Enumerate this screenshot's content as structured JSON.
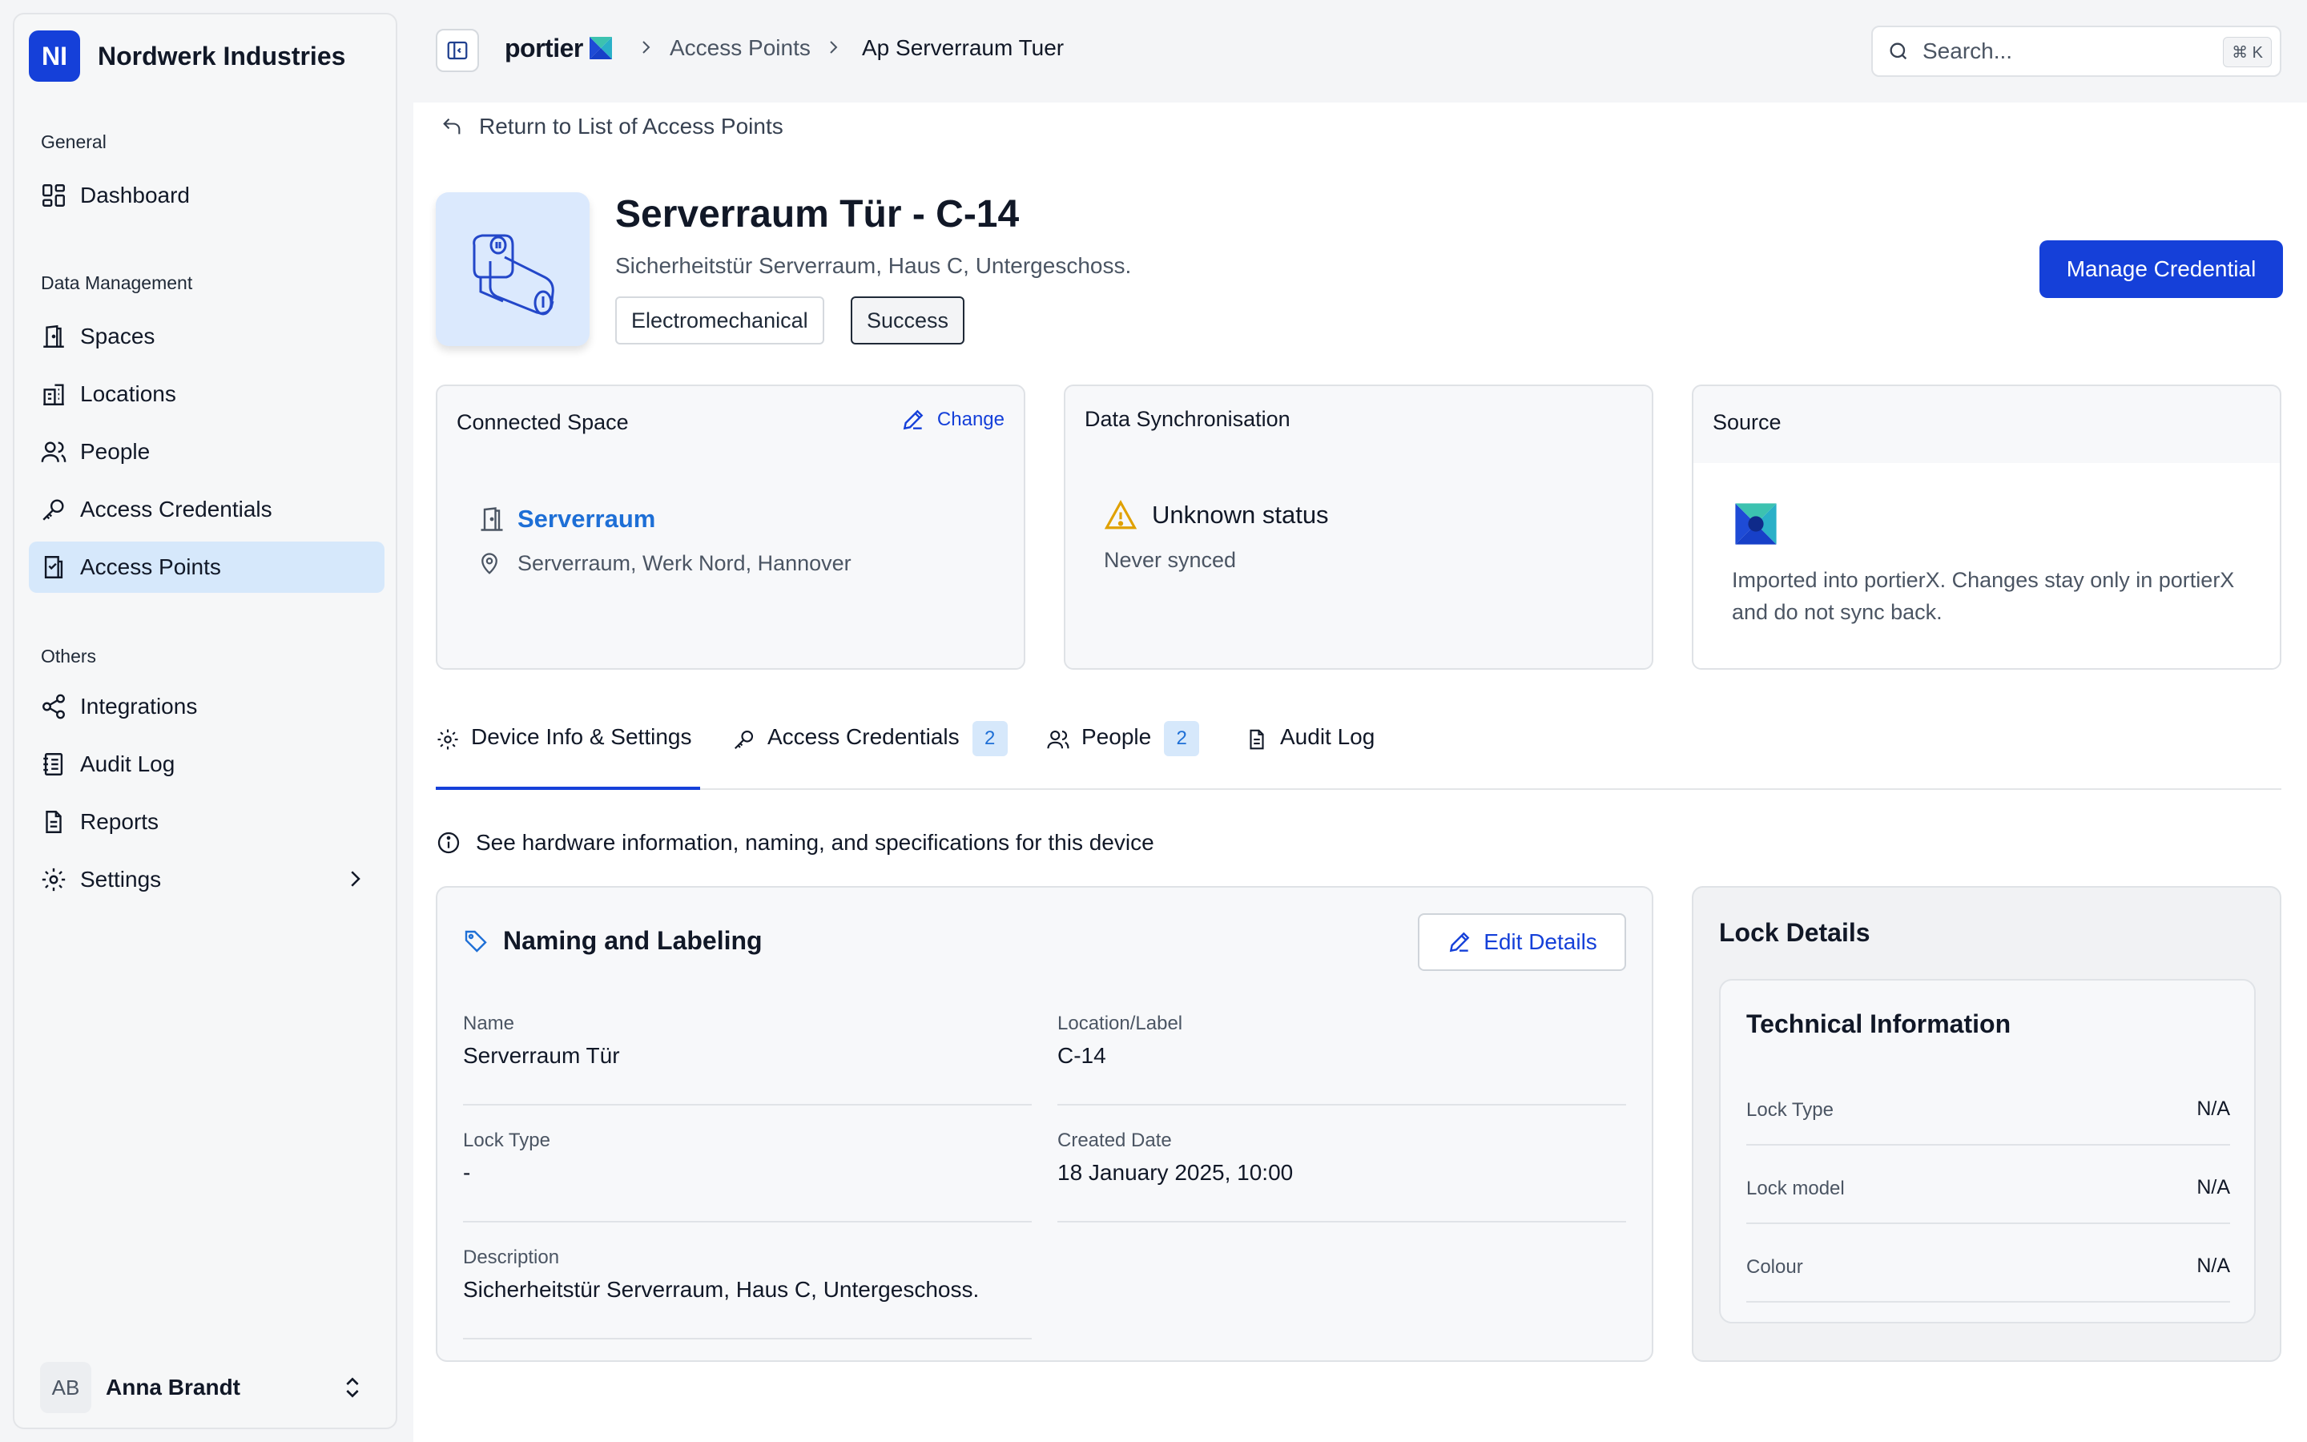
{
  "workspace": {
    "initials": "NI",
    "name": "Nordwerk Industries"
  },
  "sidebar": {
    "sections": [
      {
        "title": "General",
        "items": [
          {
            "label": "Dashboard"
          }
        ]
      },
      {
        "title": "Data Management",
        "items": [
          {
            "label": "Spaces"
          },
          {
            "label": "Locations"
          },
          {
            "label": "People"
          },
          {
            "label": "Access Credentials"
          },
          {
            "label": "Access Points"
          }
        ]
      },
      {
        "title": "Others",
        "items": [
          {
            "label": "Integrations"
          },
          {
            "label": "Audit Log"
          },
          {
            "label": "Reports"
          },
          {
            "label": "Settings"
          }
        ]
      }
    ],
    "active_item": "Access Points"
  },
  "user": {
    "initials": "AB",
    "name": "Anna Brandt"
  },
  "header": {
    "logo_text": "portier",
    "breadcrumbs": [
      "Access Points",
      "Ap Serverraum Tuer"
    ],
    "search_placeholder": "Search...",
    "search_shortcut": "⌘ K"
  },
  "page": {
    "back_link": "Return to List of Access Points",
    "title": "Serverraum Tür - C-14",
    "subtitle": "Sicherheitstür Serverraum, Haus C, Untergeschoss.",
    "tags": [
      "Electromechanical",
      "Success"
    ],
    "primary_action": "Manage Credential"
  },
  "cards": {
    "connected_space": {
      "title": "Connected Space",
      "change_label": "Change",
      "space_name": "Serverraum",
      "space_location": "Serverraum, Werk Nord, Hannover"
    },
    "sync": {
      "title": "Data Synchronisation",
      "status": "Unknown status",
      "detail": "Never synced"
    },
    "source": {
      "title": "Source",
      "text": "Imported into portierX. Changes stay only in portierX and do not sync back."
    }
  },
  "tabs": [
    {
      "label": "Device Info & Settings"
    },
    {
      "label": "Access Credentials",
      "badge": "2"
    },
    {
      "label": "People",
      "badge": "2"
    },
    {
      "label": "Audit Log"
    }
  ],
  "info_text": "See hardware information, naming, and specifications for this device",
  "naming": {
    "title": "Naming and Labeling",
    "edit_label": "Edit Details",
    "fields": {
      "name": {
        "label": "Name",
        "value": "Serverraum Tür"
      },
      "location": {
        "label": "Location/Label",
        "value": "C-14"
      },
      "lock_type": {
        "label": "Lock Type",
        "value": "-"
      },
      "created": {
        "label": "Created Date",
        "value": "18 January 2025, 10:00"
      },
      "description": {
        "label": "Description",
        "value": "Sicherheitstür Serverraum, Haus C, Untergeschoss."
      }
    }
  },
  "lock_details": {
    "title": "Lock Details",
    "technical_title": "Technical Information",
    "rows": [
      {
        "key": "Lock Type",
        "value": "N/A"
      },
      {
        "key": "Lock model",
        "value": "N/A"
      },
      {
        "key": "Colour",
        "value": "N/A"
      }
    ]
  },
  "colors": {
    "primary": "#1540d9",
    "link": "#1e6fd6",
    "active_bg": "#d6e8fb",
    "warning": "#e0a100"
  }
}
